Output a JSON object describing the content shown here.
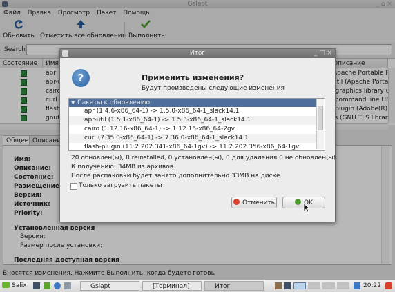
{
  "window": {
    "title": "Gslapt",
    "controls": "_ ⌂ ×"
  },
  "menu": [
    "Файл",
    "Правка",
    "Просмотр",
    "Пакет",
    "Помощь"
  ],
  "toolbar": {
    "refresh": "Обновить",
    "mark_all": "Отметить все обновления",
    "execute": "Выполнить"
  },
  "search": {
    "label": "Search",
    "value": ""
  },
  "table": {
    "headers": {
      "status": "Состояние",
      "name": "Имя",
      "description": "Описание"
    },
    "rows": [
      {
        "name": "apr",
        "description": "Apache Portable Ru"
      },
      {
        "name": "apr-u",
        "description": "util (Apache Portabl"
      },
      {
        "name": "cairo",
        "description": "(graphics library u"
      },
      {
        "name": "curl",
        "description": "(command line URL"
      },
      {
        "name": "flash",
        "description": "-plugin (Adobe(R) f"
      },
      {
        "name": "gnut",
        "description": "ls (GNU TLS library"
      }
    ]
  },
  "details": {
    "tabs": [
      "Общее",
      "Описани"
    ],
    "labels": [
      "Имя:",
      "Описание:",
      "Состояние:",
      "Размещение:",
      "Версия:",
      "Источник:",
      "Priority:"
    ],
    "installed_header": "Установленная версия",
    "installed_version": "Версия:",
    "installed_size": "Размер после установки:",
    "latest_header": "Последняя доступная версия"
  },
  "status_text": "Вносятся изменения. Нажмите Выполнить, когда будете готовы",
  "taskbar": {
    "start": "Salix",
    "windows": [
      "Gslapt",
      "[Терминал]",
      "Итог"
    ],
    "clock": "20:22"
  },
  "dialog": {
    "title": "Итог",
    "controls": "_ □ ×",
    "heading": "Применить изменения?",
    "subheading": "Будут произведены следующие изменения",
    "list_header": "Пакеты к обновлению",
    "items": [
      "apr (1.4.6-x86_64-1) -> 1.5.0-x86_64-1_slack14.1",
      "apr-util (1.5.1-x86_64-1) -> 1.5.3-x86_64-1_slack14.1",
      "cairo (1.12.16-x86_64-1) -> 1.12.16-x86_64-2gv",
      "curl (7.35.0-x86_64-1) -> 7.36.0-x86_64-1_slack14.1",
      "flash-plugin (11.2.202.341-x86_64-1gv) -> 11.2.202.356-x86_64-1gv"
    ],
    "summary": [
      "20 обновлен(ы), 0 reinstalled, 0 установлен(ы), 0 для удаления 0 не обновлен(ы).",
      "К получению: 34MB из архивов.",
      "После распаковки будет занято дополнительно 33MB на диске."
    ],
    "download_only": "Только загрузить пакеты",
    "cancel": "Отменить",
    "ok": "OK"
  },
  "colors": {
    "accent": "#4f6f9a",
    "cancel": "#d9412b",
    "ok": "#4c9a2a"
  }
}
